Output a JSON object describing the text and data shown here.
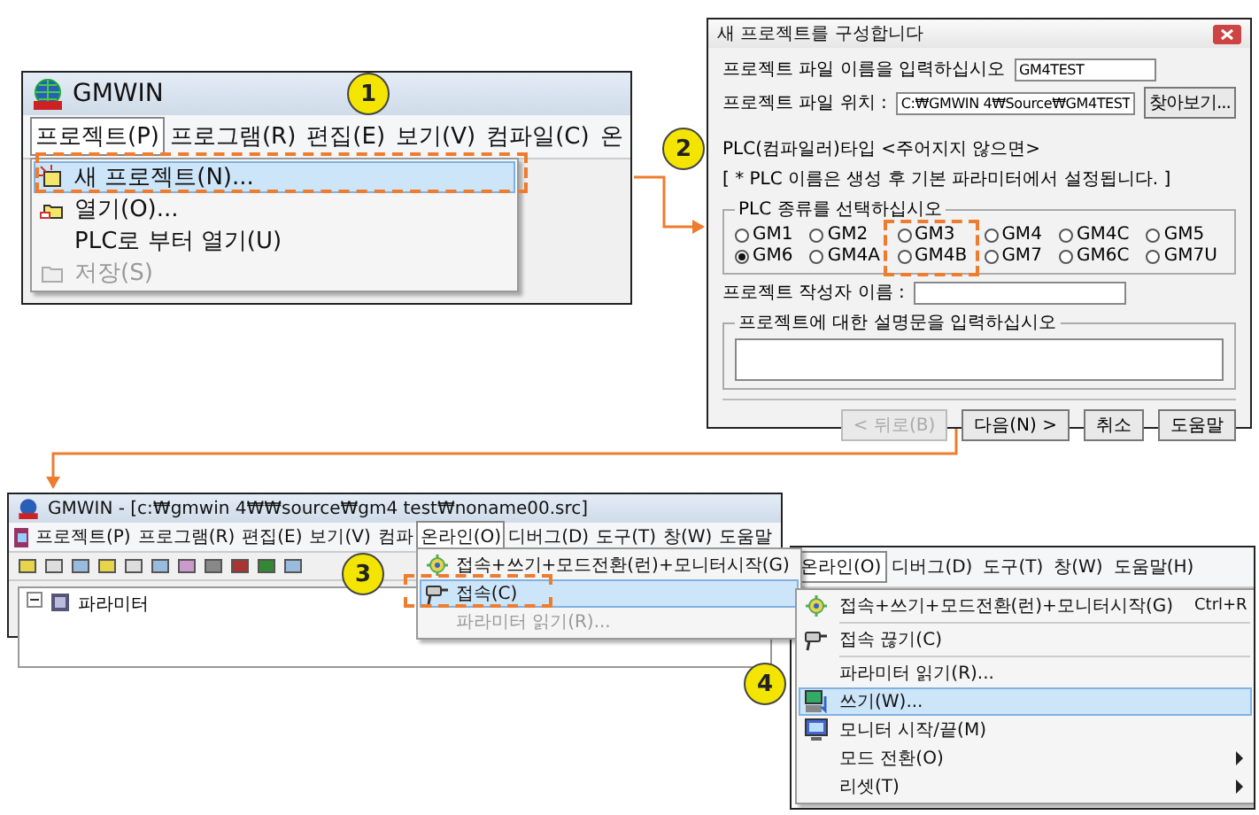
{
  "project_menu_window": {
    "callout": "1",
    "title": "GMWIN",
    "menu": [
      {
        "label": "프로젝트(P)",
        "selected": true,
        "dropdown": [
          {
            "label": "새 프로젝트(N)...",
            "kind": "new",
            "selected": true,
            "disabled": false
          },
          {
            "label": "열기(O)...",
            "kind": "open",
            "selected": false,
            "disabled": false
          },
          {
            "label": "PLC로 부터 열기(U)",
            "kind": "plain",
            "selected": false,
            "disabled": false
          },
          {
            "label": "저장(S)",
            "kind": "save",
            "selected": false,
            "disabled": true
          }
        ]
      },
      {
        "label": "프로그램(R)",
        "selected": false
      },
      {
        "label": "편집(E)",
        "selected": false
      },
      {
        "label": "보기(V)",
        "selected": false
      },
      {
        "label": "컴파일(C)",
        "selected": false
      },
      {
        "label": "온",
        "selected": false
      }
    ]
  },
  "new_project_dialog": {
    "callout": "2",
    "title": "새 프로젝트를 구성합니다",
    "fields": [
      {
        "label": "프로젝트 파일 이름을 입력하십시오",
        "value": "GM4TEST"
      },
      {
        "label": "프로젝트 파일 위치 :",
        "value": "C:₩GMWIN 4₩Source₩GM4TEST"
      }
    ],
    "browse_button": "찾아보기...",
    "notes": [
      "PLC(컴파일러)타입 <주어지지 않으면>",
      "[ * PLC 이름은 생성 후 기본 파라미터에서 설정됩니다. ]"
    ],
    "plc_group": {
      "legend": "PLC 종류를 선택하십시오",
      "options": [
        {
          "label": "GM1",
          "selected": false
        },
        {
          "label": "GM2",
          "selected": false
        },
        {
          "label": "GM3",
          "selected": false
        },
        {
          "label": "GM4",
          "selected": false
        },
        {
          "label": "GM4C",
          "selected": false
        },
        {
          "label": "GM5",
          "selected": false
        },
        {
          "label": "GM6",
          "selected": true
        },
        {
          "label": "GM4A",
          "selected": false
        },
        {
          "label": "GM4B",
          "selected": false
        },
        {
          "label": "GM7",
          "selected": false
        },
        {
          "label": "GM6C",
          "selected": false
        },
        {
          "label": "GM7U",
          "selected": false
        }
      ]
    },
    "author": {
      "label": "프로젝트 작성자 이름 :"
    },
    "description": {
      "legend": "프로젝트에 대한 설명문을 입력하십시오"
    },
    "buttons": [
      {
        "label": "< 뒤로(B)",
        "disabled": true
      },
      {
        "label": "다음(N) >",
        "disabled": false
      },
      {
        "label": "취소",
        "disabled": false
      },
      {
        "label": "도움말",
        "disabled": false
      }
    ]
  },
  "online_menu_window": {
    "callout": "3",
    "title": "GMWIN - [c:₩gmwin 4₩₩source₩gm4 test₩noname00.src]",
    "menu": [
      {
        "label": "프로젝트(P)",
        "selected": false
      },
      {
        "label": "프로그램(R)",
        "selected": false
      },
      {
        "label": "편집(E)",
        "selected": false
      },
      {
        "label": "보기(V)",
        "selected": false
      },
      {
        "label": "컴파",
        "selected": false
      },
      {
        "label": "온라인(O)",
        "selected": true,
        "dropdown": [
          {
            "label": "접속+쓰기+모드전환(런)+모니터시작(G)",
            "kind": "run",
            "selected": false,
            "disabled": false
          },
          {
            "label": "접속(C)",
            "kind": "connect",
            "selected": true,
            "disabled": false
          },
          {
            "label": "파라미터 읽기(R)...",
            "kind": "plain",
            "selected": false,
            "disabled": true
          }
        ]
      },
      {
        "label": "디버그(D)",
        "selected": false
      },
      {
        "label": "도구(T)",
        "selected": false
      },
      {
        "label": "창(W)",
        "selected": false
      },
      {
        "label": "도움말",
        "selected": false
      }
    ],
    "tree": [
      {
        "label": "파라미터",
        "expanded": true
      }
    ]
  },
  "online_menu_zoom": {
    "callout": "4",
    "menu": [
      {
        "label": "온라인(O)",
        "selected": true,
        "dropdown": [
          {
            "label": "접속+쓰기+모드전환(런)+모니터시작(G)",
            "shortcut": "Ctrl+R",
            "kind": "run",
            "selected": false,
            "disabled": false,
            "submenu": false,
            "separator_after": true
          },
          {
            "label": "접속 끊기(C)",
            "kind": "connect",
            "selected": false,
            "disabled": false,
            "submenu": false,
            "separator_after": true
          },
          {
            "label": "파라미터 읽기(R)...",
            "kind": "plain",
            "selected": false,
            "disabled": false,
            "submenu": false,
            "separator_after": false
          },
          {
            "label": "쓰기(W)...",
            "kind": "write",
            "selected": true,
            "disabled": false,
            "submenu": false,
            "separator_after": false
          },
          {
            "label": "모니터 시작/끝(M)",
            "kind": "monitor",
            "selected": false,
            "disabled": false,
            "submenu": false,
            "separator_after": false
          },
          {
            "label": "모드 전환(O)",
            "kind": "plain",
            "selected": false,
            "disabled": false,
            "submenu": true,
            "separator_after": false
          },
          {
            "label": "리셋(T)",
            "kind": "plain",
            "selected": false,
            "disabled": false,
            "submenu": true,
            "separator_after": false
          }
        ]
      },
      {
        "label": "디버그(D)",
        "selected": false
      },
      {
        "label": "도구(T)",
        "selected": false
      },
      {
        "label": "창(W)",
        "selected": false
      },
      {
        "label": "도움말(H)",
        "selected": false
      }
    ]
  }
}
